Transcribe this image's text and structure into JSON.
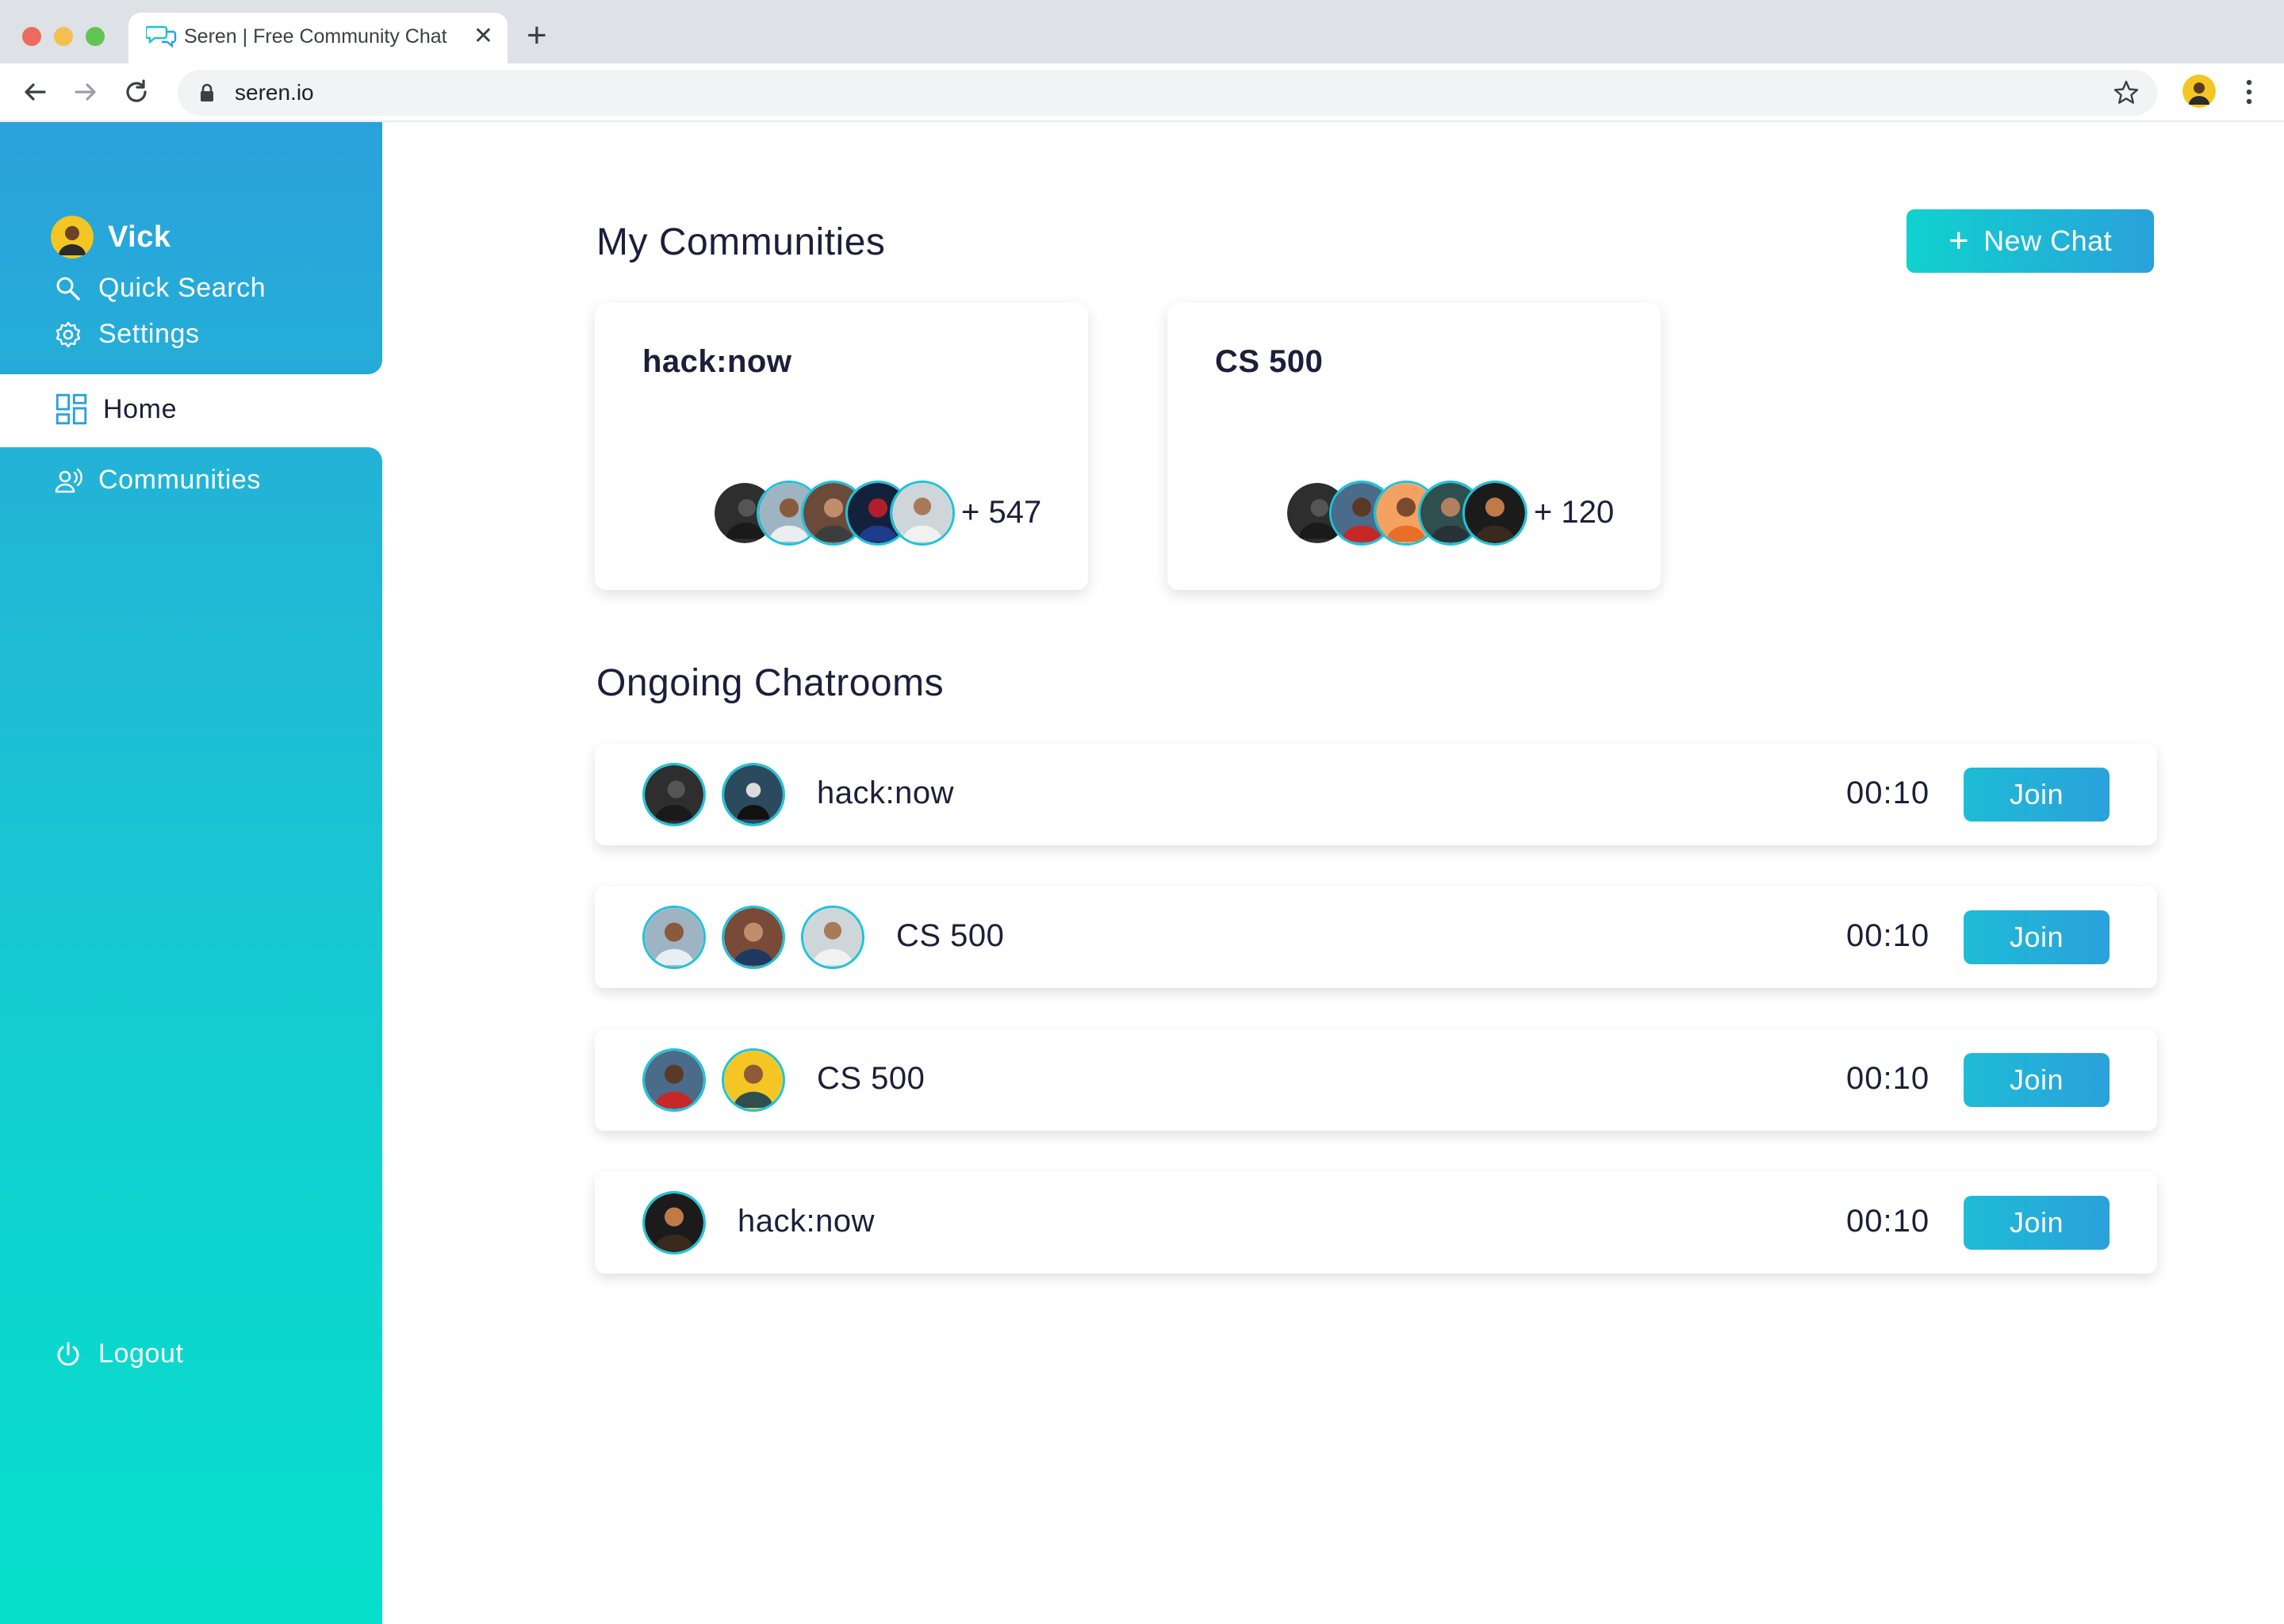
{
  "browser": {
    "tab_title": "Seren | Free Community Chat",
    "url": "seren.io"
  },
  "sidebar": {
    "user_name": "Vick",
    "items": [
      {
        "label": "Quick Search",
        "icon": "search-icon"
      },
      {
        "label": "Settings",
        "icon": "gear-icon"
      },
      {
        "label": "Home",
        "icon": "dashboard-icon"
      },
      {
        "label": "Communities",
        "icon": "community-icon"
      }
    ],
    "logout_label": "Logout"
  },
  "main": {
    "communities_title": "My Communities",
    "new_chat_label": "New Chat",
    "communities": [
      {
        "name": "hack:now",
        "count": "+ 547"
      },
      {
        "name": "CS 500",
        "count": "+ 120"
      }
    ],
    "chatrooms_title": "Ongoing Chatrooms",
    "chatrooms": [
      {
        "name": "hack:now",
        "time": "00:10",
        "join_label": "Join"
      },
      {
        "name": "CS 500",
        "time": "00:10",
        "join_label": "Join"
      },
      {
        "name": "CS 500",
        "time": "00:10",
        "join_label": "Join"
      },
      {
        "name": "hack:now",
        "time": "00:10",
        "join_label": "Join"
      }
    ]
  },
  "colors": {
    "sidebar_top": "#2aa1db",
    "sidebar_bottom": "#06dfcb",
    "accent_border": "#1ec3d9",
    "text_dark": "#1c1f3a"
  }
}
